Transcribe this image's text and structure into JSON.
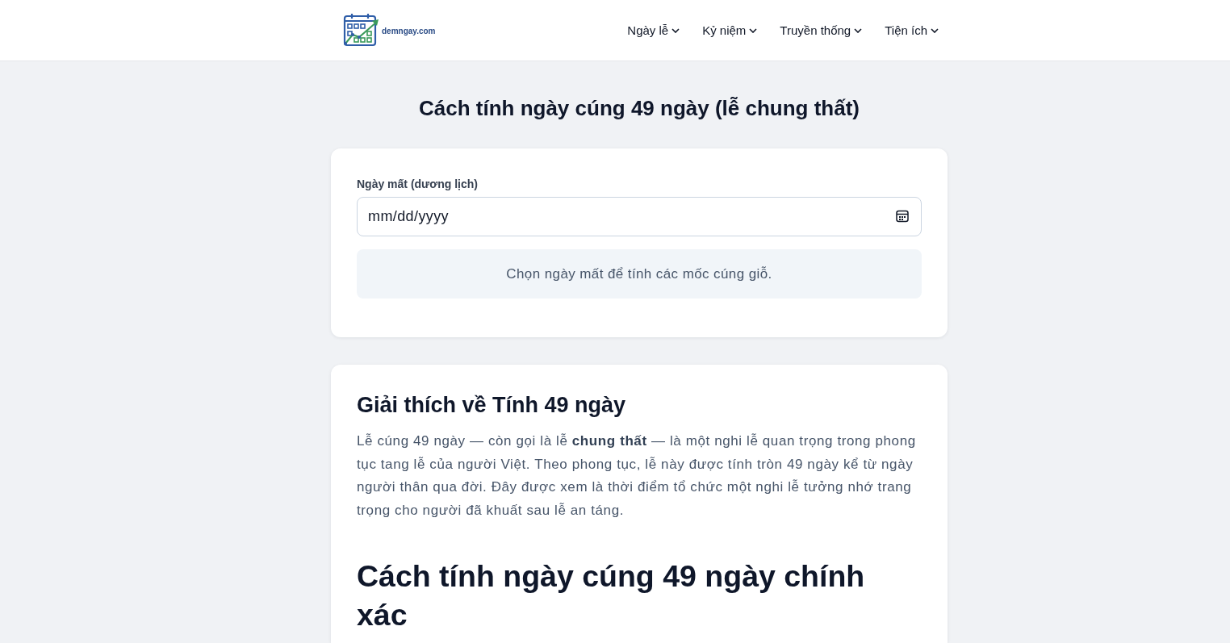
{
  "header": {
    "site_name": "demngay.com",
    "nav": [
      {
        "label": "Ngày lễ"
      },
      {
        "label": "Kỷ niệm"
      },
      {
        "label": "Truyền thống"
      },
      {
        "label": "Tiện ích"
      }
    ]
  },
  "page_title": "Cách tính ngày cúng 49 ngày (lễ chung thất)",
  "calculator": {
    "date_label": "Ngày mất (dương lịch)",
    "date_field": {
      "placeholder": "mm/dd/yyyy"
    },
    "result_message": "Chọn ngày mất để tính các mốc cúng giỗ."
  },
  "article": {
    "blocks": [
      {
        "kind": "heading",
        "text": "Giải thích về Tính 49 ngày"
      },
      {
        "kind": "paragraph",
        "text": "Lễ cúng 49 ngày — còn gọi là lễ **chung thất** — là một nghi lễ quan trọng trong phong tục tang lễ của người Việt. Theo phong tục, lễ này được tính tròn 49 ngày kể từ ngày người thân qua đời. Đây được xem là thời điểm tổ chức một nghi lễ tưởng nhớ trang trọng cho người đã khuất sau lễ an táng."
      },
      {
        "kind": "headline",
        "text": "Cách tính ngày cúng 49 ngày chính xác"
      }
    ]
  }
}
